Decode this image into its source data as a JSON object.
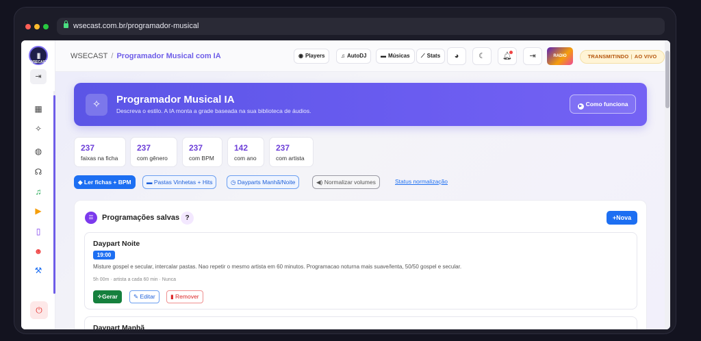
{
  "browser": {
    "url": "wsecast.com.br/programador-musical"
  },
  "sidebar": {
    "logo_text": "WSECAST",
    "collapse_icon": "indent-icon",
    "items": [
      {
        "icon": "dashboard-icon",
        "glyph": "▦",
        "color": "#444444"
      },
      {
        "icon": "magic-wand-icon",
        "glyph": "✧",
        "color": "#444444"
      },
      {
        "icon": "globe-icon",
        "glyph": "◍",
        "color": "#444444"
      },
      {
        "icon": "headphones-icon",
        "glyph": "☊",
        "color": "#444444"
      },
      {
        "icon": "music-note-icon",
        "glyph": "♫",
        "color": "#16a34a"
      },
      {
        "icon": "play-circle-icon",
        "glyph": "▶",
        "color": "#f59e0b"
      },
      {
        "icon": "mobile-icon",
        "glyph": "▯",
        "color": "#7c3aed"
      },
      {
        "icon": "users-icon",
        "glyph": "☻",
        "color": "#ef4444"
      },
      {
        "icon": "wrench-icon",
        "glyph": "⚒",
        "color": "#1d6ff2"
      }
    ],
    "power_icon": "power-icon"
  },
  "topbar": {
    "breadcrumb_root": "WSECAST",
    "breadcrumb_separator": "/",
    "breadcrumb_current": "Programador Musical com IA",
    "buttons": {
      "players": "Players",
      "autodj": "AutoDJ",
      "musicas": "Músicas",
      "stats": "Stats"
    },
    "avatar_text": "RADIO",
    "live_status_1": "TRANSMITINDO",
    "live_status_sep": "|",
    "live_status_2": "AO VIVO"
  },
  "hero": {
    "title": "Programador Musical IA",
    "subtitle": "Descreva o estilo. A IA monta a grade baseada na sua biblioteca de áudios.",
    "how_button": "Como funciona"
  },
  "stats": [
    {
      "value": "237",
      "label": "faixas na ficha"
    },
    {
      "value": "237",
      "label": "com gênero"
    },
    {
      "value": "237",
      "label": "com BPM"
    },
    {
      "value": "142",
      "label": "com ano"
    },
    {
      "value": "237",
      "label": "com artista"
    }
  ],
  "actions": {
    "read_tags": "Ler fichas + BPM",
    "folders": "Pastas Vinhetas + Hits",
    "dayparts": "Dayparts Manhã/Noite",
    "normalize": "Normalizar volumes",
    "status_link": "Status normalização"
  },
  "saved": {
    "title": "Programações salvas",
    "help": "?",
    "new_button": "Nova",
    "items": [
      {
        "name": "Daypart Noite",
        "time": "19:00",
        "description": "Misture gospel e secular, intercalar pastas. Nao repetir o mesmo artista em 60 minutos. Programacao noturna mais suave/lenta, 50/50 gospel e secular.",
        "meta": "5h 00m · artista a cada 60 min · Nunca",
        "generate": "Gerar",
        "edit": "Editar",
        "remove": "Remover"
      },
      {
        "name": "Daypart Manhã"
      }
    ]
  },
  "colors": {
    "accent": "#6d5ce8",
    "primary_blue": "#1d6ff2",
    "success_green": "#15803d",
    "danger_red": "#dc2626",
    "live_amber": "#b45309"
  }
}
